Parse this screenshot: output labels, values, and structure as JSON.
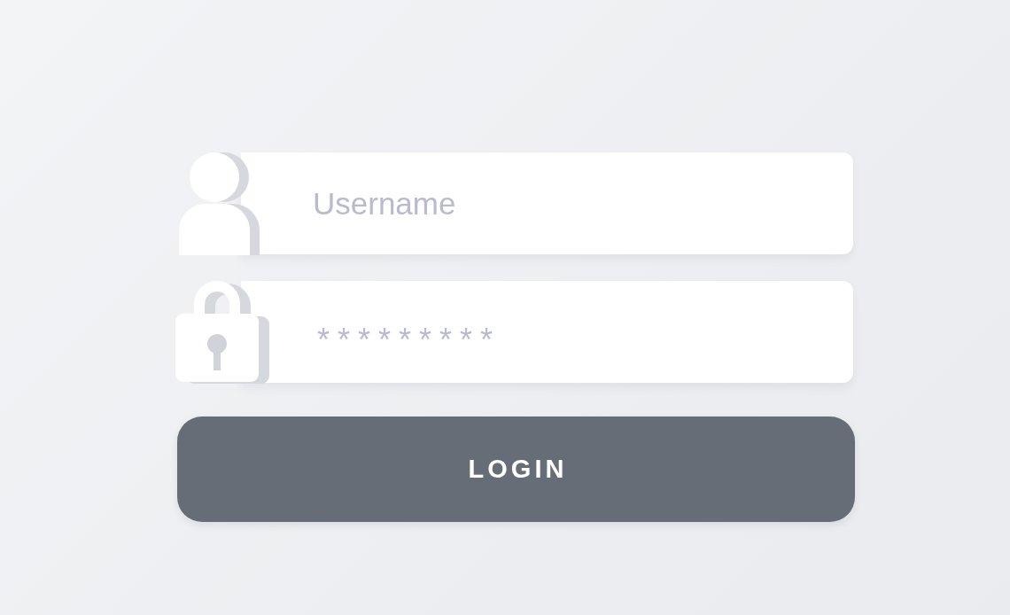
{
  "fields": [
    {
      "kind": "username",
      "placeholder": "Username"
    },
    {
      "kind": "password",
      "value": "*********"
    }
  ],
  "login_button": {
    "label": "LOGIN"
  }
}
